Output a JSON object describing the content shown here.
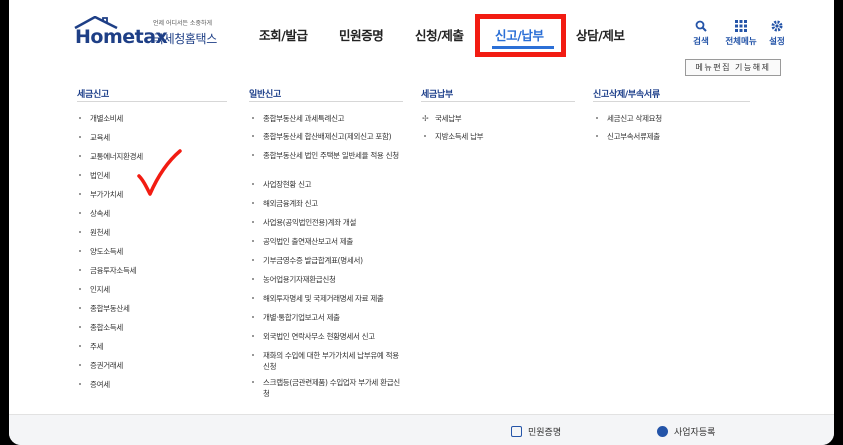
{
  "logo": {
    "wordmark": "Hometax",
    "subtitle": "언제 어디서든 소중하게",
    "title": "국세청홈택스"
  },
  "nav": {
    "items": [
      {
        "label": "조회/발급"
      },
      {
        "label": "민원증명"
      },
      {
        "label": "신청/제출"
      },
      {
        "label": "신고/납부"
      },
      {
        "label": "상담/제보"
      }
    ],
    "active": "신고/납부"
  },
  "utility": {
    "search": "검색",
    "all_menu": "전체메뉴",
    "settings": "설정"
  },
  "edit_button": "메뉴편집 기능해제",
  "columns": [
    {
      "title": "세금신고",
      "items": [
        "개별소비세",
        "교육세",
        "교통에너지환경세",
        "법인세",
        "부가가치세",
        "상속세",
        "원천세",
        "양도소득세",
        "금융투자소득세",
        "인지세",
        "종합부동산세",
        "종합소득세",
        "주세",
        "증권거래세",
        "증여세"
      ]
    },
    {
      "title": "일반신고",
      "items": [
        "종합부동산세 과세특례신고",
        "종합부동산세 합산배제신고(제외신고 포함)",
        "종합부동산세 법인 주택분 일반세율 적용 신청",
        "사업장현황 신고",
        "해외금융계좌 신고",
        "사업용(공익법인전용)계좌 개설",
        "공익법인 출연재산보고서 제출",
        "기부금영수증 발급합계표(명세서)",
        "농어업용기자재환급신청",
        "해외투자명세 및 국제거래명세 자료 제출",
        "개별·통합기업보고서 제출",
        "외국법인 연락사무소 현황명세서 신고",
        "재화의 수입에 대한 부가가치세 납부유예 적용 신청",
        "스크랩등(금관련제품) 수입업자 부가세 환급신청"
      ]
    },
    {
      "title": "세금납부",
      "items": [
        "국세납부",
        "지방소득세 납부"
      ]
    },
    {
      "title": "신고삭제/부속서류",
      "items": [
        "세금신고 삭제요청",
        "신고부속서류제출"
      ]
    }
  ],
  "bottom": {
    "left_link": "민원증명",
    "right_link": "사업자등록"
  },
  "colors": {
    "brand": "#1e3f86",
    "active": "#2b6fd6",
    "highlight": "#f21c12"
  }
}
